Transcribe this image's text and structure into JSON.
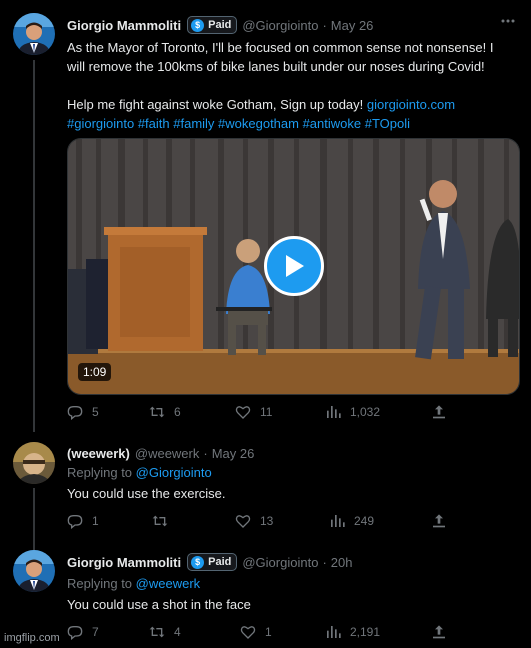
{
  "colors": {
    "accent": "#1d9bf0",
    "muted": "#71767b",
    "background": "#000000"
  },
  "tweet1": {
    "name": "Giorgio Mammoliti",
    "badge": "Paid",
    "handle": "@Giorgiointo",
    "dot": "·",
    "time": "May 26",
    "more_icon": "more-icon",
    "text_line1": "As the Mayor of Toronto, I'll be focused on common sense not nonsense! I",
    "text_line2": "will remove the 100kms of bike lanes built under our noses during Covid!",
    "text_line3": "Help me fight against woke Gotham, Sign up today! ",
    "link": "giorgiointo.com",
    "hashtags": "#giorgiointo #faith #family #wokegotham #antiwoke #TOpoli",
    "video_duration": "1:09",
    "replies": "5",
    "retweets": "6",
    "likes": "11",
    "views": "1,032"
  },
  "tweet2": {
    "name": "(weewerk)",
    "handle": "@weewerk",
    "dot": "·",
    "time": "May 26",
    "replying_prefix": "Replying to ",
    "replying_to": "@Giorgiointo",
    "text": "You could use the exercise.",
    "replies": "1",
    "retweets": "",
    "likes": "13",
    "views": "249"
  },
  "tweet3": {
    "name": "Giorgio Mammoliti",
    "badge": "Paid",
    "handle": "@Giorgiointo",
    "dot": "·",
    "time": "20h",
    "replying_prefix": "Replying to ",
    "replying_to": "@weewerk",
    "text": "You could use a shot in the face",
    "replies": "7",
    "retweets": "4",
    "likes": "1",
    "views": "2,191"
  },
  "watermark": "imgflip.com"
}
